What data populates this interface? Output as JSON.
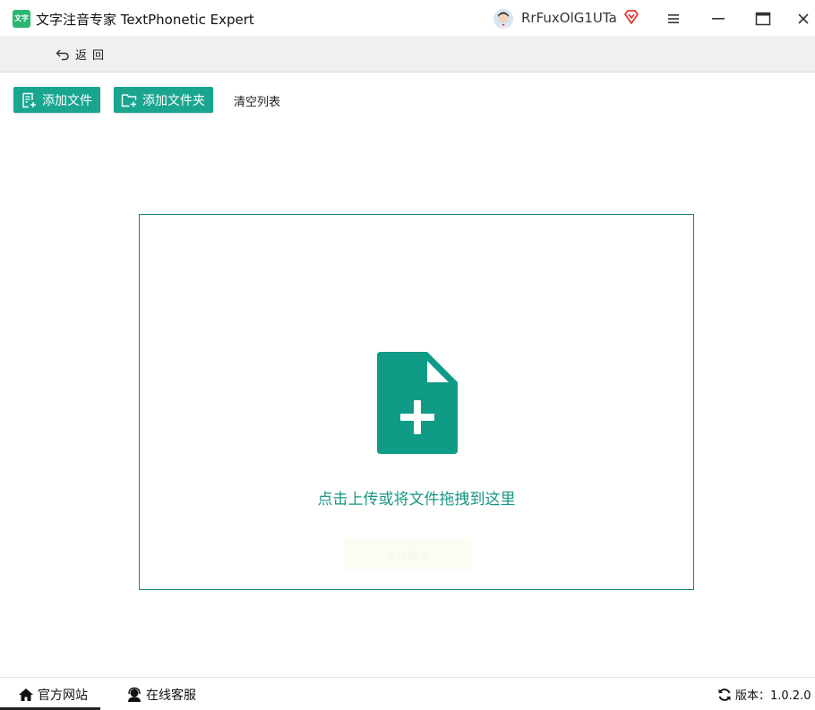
{
  "app": {
    "logo_text": "文字",
    "title": "文字注音专家 TextPhonetic Expert"
  },
  "user": {
    "name": "RrFuxOlG1UTa"
  },
  "nav": {
    "back_label": "返回"
  },
  "toolbar": {
    "add_file_label": "添加文件",
    "add_folder_label": "添加文件夹",
    "clear_label": "清空列表"
  },
  "dropzone": {
    "hint": "点击上传或将文件拖拽到这里",
    "faint_text": "支持格式"
  },
  "footer": {
    "website_label": "官方网站",
    "service_label": "在线客服",
    "version_label": "版本：1.0.2.0"
  },
  "colors": {
    "accent": "#1aa58f",
    "dropzone_border": "#16887a",
    "icon_fill": "#0f9b86",
    "vip": "#e53935"
  }
}
